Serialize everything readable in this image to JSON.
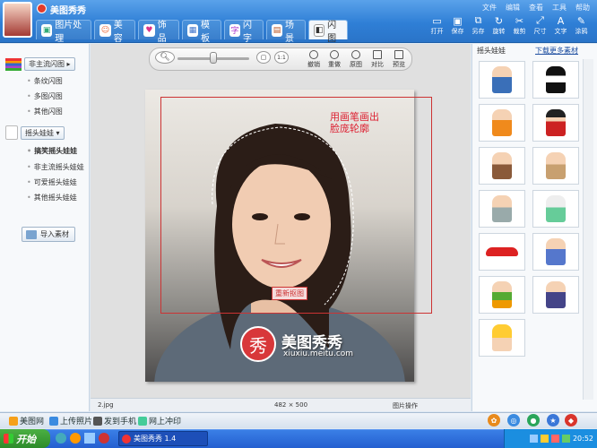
{
  "app": {
    "title": "美图秀秀"
  },
  "menu": [
    "文件",
    "编辑",
    "查看",
    "工具",
    "帮助"
  ],
  "tabs": [
    {
      "label": "图片处理",
      "icon": "picture-icon"
    },
    {
      "label": "美容",
      "icon": "face-icon"
    },
    {
      "label": "饰品",
      "icon": "accessory-icon"
    },
    {
      "label": "模板",
      "icon": "template-icon"
    },
    {
      "label": "闪字",
      "icon": "flash-text-icon"
    },
    {
      "label": "场景",
      "icon": "scene-icon"
    },
    {
      "label": "闪图",
      "icon": "flash-image-icon"
    }
  ],
  "toolbar": [
    {
      "label": "打开",
      "icon": "open-folder-icon"
    },
    {
      "label": "保存",
      "icon": "save-icon"
    },
    {
      "label": "另存",
      "icon": "save-as-icon"
    },
    {
      "label": "旋转",
      "icon": "rotate-icon"
    },
    {
      "label": "裁剪",
      "icon": "crop-icon"
    },
    {
      "label": "尺寸",
      "icon": "resize-icon"
    },
    {
      "label": "文字",
      "icon": "text-icon"
    },
    {
      "label": "涂鸦",
      "icon": "doodle-icon"
    }
  ],
  "sidebar": {
    "group1": {
      "label": "非主流闪图",
      "items": [
        "条纹闪图",
        "多图闪图",
        "其他闪图"
      ]
    },
    "group2": {
      "label": "摇头娃娃",
      "items": [
        "搞笑摇头娃娃",
        "非主流摇头娃娃",
        "可爱摇头娃娃",
        "其他摇头娃娃"
      ]
    },
    "import_label": "导入素材"
  },
  "editbar": {
    "actions": [
      {
        "label": "撤销",
        "icon": "undo-icon"
      },
      {
        "label": "重做",
        "icon": "redo-icon"
      },
      {
        "label": "原图",
        "icon": "original-icon"
      },
      {
        "label": "对比",
        "icon": "compare-icon"
      },
      {
        "label": "预览",
        "icon": "preview-icon"
      }
    ]
  },
  "canvas": {
    "hint": "用画笔画出脸庞轮廓",
    "reselect_label": "重新抠图",
    "watermark_logo": "秀",
    "watermark_text": "美图秀秀",
    "watermark_url": "xiuxiu.meitu.com"
  },
  "status": {
    "filename": "2.jpg",
    "dimensions": "482 × 500",
    "mode": "图片操作"
  },
  "rightpanel": {
    "title": "摇头娃娃",
    "more_label": "下载更多素材"
  },
  "footer": [
    {
      "label": "美图网",
      "icon": "meitu-icon"
    },
    {
      "label": "上传照片",
      "icon": "upload-icon"
    },
    {
      "label": "发到手机",
      "icon": "phone-icon"
    },
    {
      "label": "网上冲印",
      "icon": "print-icon"
    }
  ],
  "taskbar": {
    "start": "开始",
    "task": "美图秀秀 1.4",
    "clock": "20:52"
  }
}
